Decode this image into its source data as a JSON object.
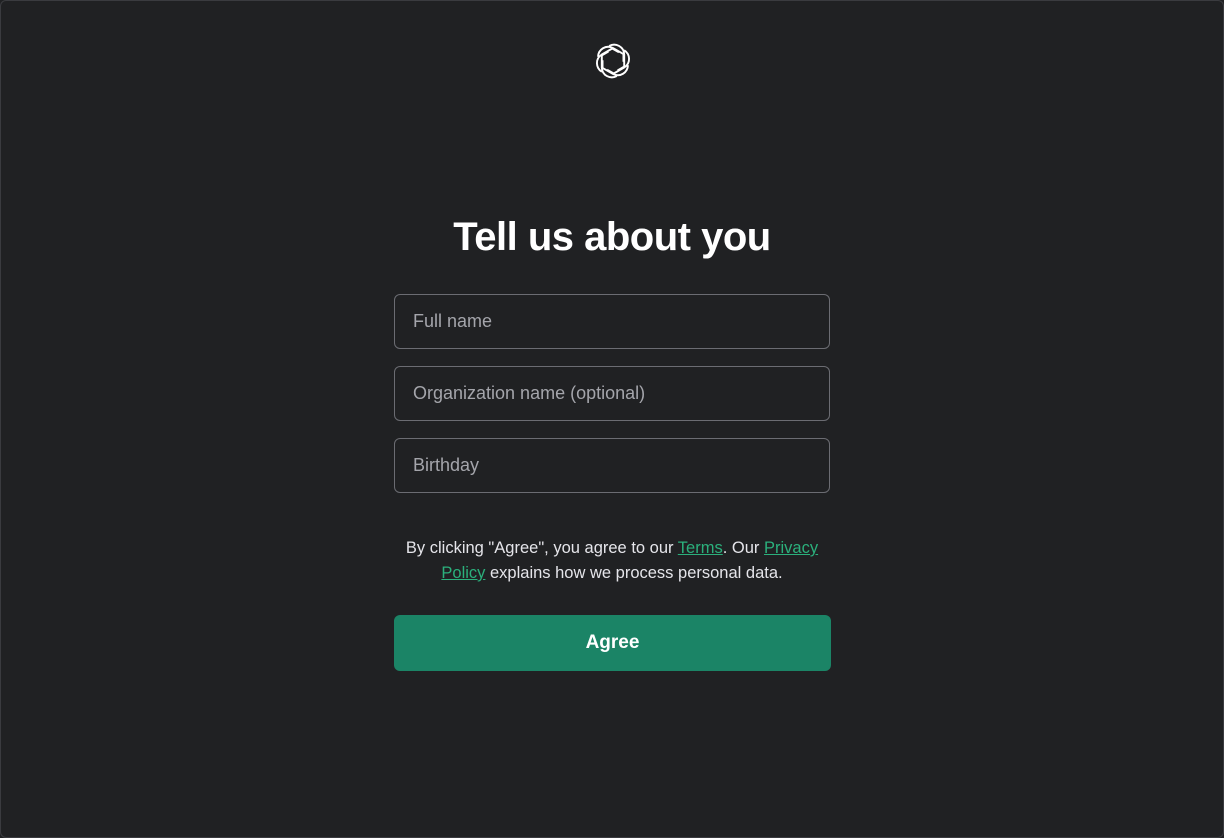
{
  "title": "Tell us about you",
  "fields": {
    "full_name": {
      "placeholder": "Full name",
      "value": ""
    },
    "organization": {
      "placeholder": "Organization name (optional)",
      "value": ""
    },
    "birthday": {
      "placeholder": "Birthday",
      "value": ""
    }
  },
  "legal": {
    "prefix": "By clicking \"Agree\", you agree to our ",
    "terms_link": "Terms",
    "middle": ". Our ",
    "privacy_link": "Privacy Policy",
    "suffix": " explains how we process personal data."
  },
  "agree_button": "Agree",
  "colors": {
    "background": "#202123",
    "accent": "#1b8466",
    "link": "#2bb07c"
  },
  "icons": {
    "logo": "openai-logo-icon"
  }
}
